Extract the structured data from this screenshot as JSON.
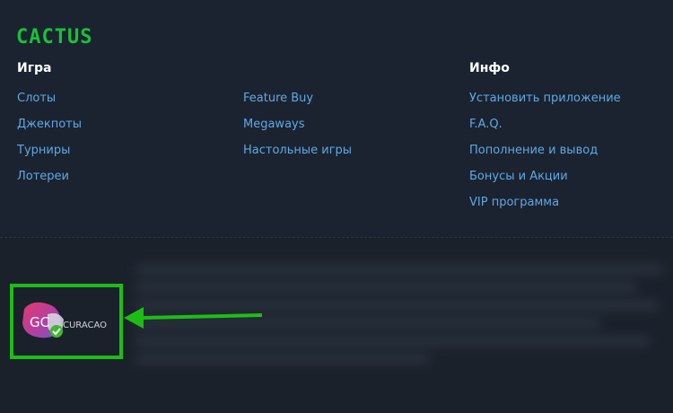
{
  "brand": {
    "logo_text": "CACTUS",
    "logo_color": "#18c236"
  },
  "columns": [
    {
      "title": "Игра",
      "links": [
        "Слоты",
        "Джекпоты",
        "Турниры",
        "Лотереи"
      ]
    },
    {
      "title": "",
      "links": [
        "Feature Buy",
        "Megaways",
        "Настольные игры"
      ]
    },
    {
      "title": "Инфо",
      "links": [
        "Установить приложение",
        "F.A.Q.",
        "Пополнение и вывод",
        "Бонусы и Акции",
        "VIP программа"
      ]
    }
  ],
  "license": {
    "badge_main": "GC",
    "badge_sub": "CURACAO",
    "highlight_color": "#1ebd16",
    "icon": "checkmark-icon"
  },
  "colors": {
    "background": "#1b2330",
    "link": "#5fa8e4",
    "heading": "#ffffff",
    "annotation": "#1ebd16"
  }
}
